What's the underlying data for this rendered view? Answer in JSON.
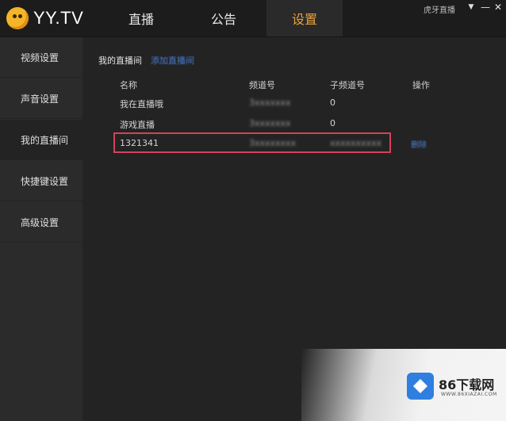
{
  "app": {
    "logo_text": "YY.TV"
  },
  "nav": [
    {
      "label": "直播"
    },
    {
      "label": "公告"
    },
    {
      "label": "设置"
    }
  ],
  "window": {
    "user": "虎牙直播",
    "menu": "▼",
    "minimize": "—",
    "close": "✕"
  },
  "sidebar": {
    "items": [
      {
        "label": "视频设置"
      },
      {
        "label": "声音设置"
      },
      {
        "label": "我的直播间"
      },
      {
        "label": "快捷键设置"
      },
      {
        "label": "高级设置"
      }
    ]
  },
  "main": {
    "title": "我的直播间",
    "link": "添加直播间",
    "columns": [
      "名称",
      "频道号",
      "子频道号",
      "操作"
    ],
    "rows": [
      {
        "name": "我在直播哦",
        "channel": "3xxxxxxx",
        "subchannel": "0"
      },
      {
        "name": "游戏直播",
        "channel": "3xxxxxxx",
        "subchannel": "0"
      },
      {
        "name": "1321341",
        "channel": "3xxxxxxxx",
        "subchannel": "xxxxxxxxxx",
        "action": "删除"
      }
    ]
  },
  "watermark": {
    "brand": "86下载网",
    "url": "WWW.86XIAZAI.COM"
  },
  "colors": {
    "accent": "#e8a23a",
    "highlight_border": "#d4415b",
    "link": "#4a7fd6"
  }
}
